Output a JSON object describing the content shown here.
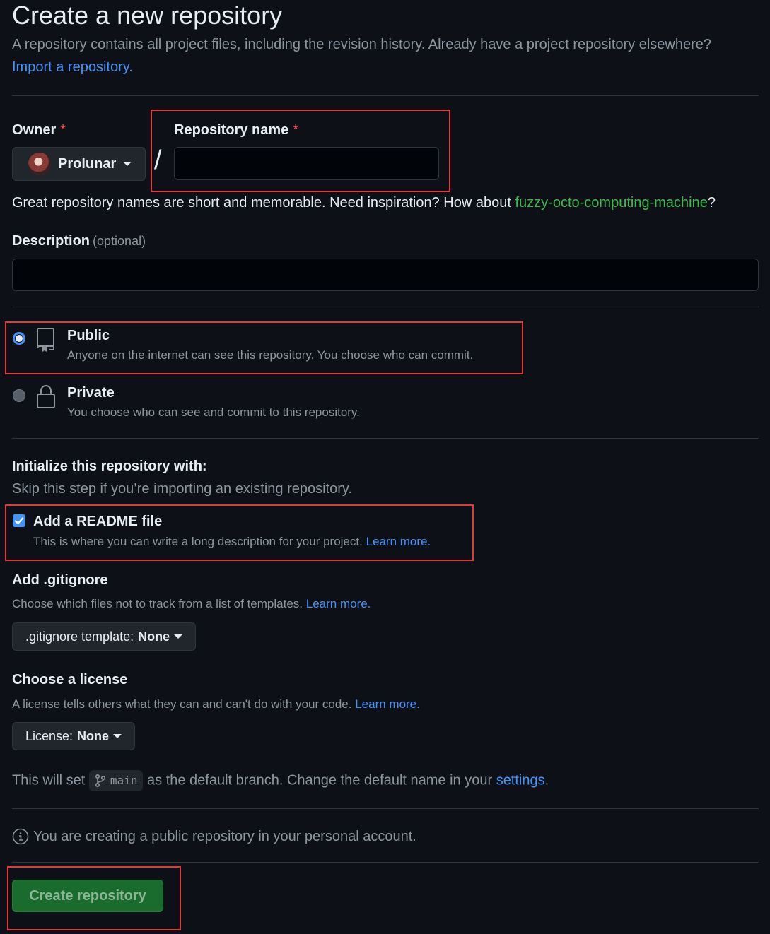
{
  "header": {
    "title": "Create a new repository",
    "subtitle": "A repository contains all project files, including the revision history. Already have a project repository elsewhere?",
    "import_link": "Import a repository."
  },
  "owner": {
    "label": "Owner",
    "required_mark": "*",
    "value": "Prolunar"
  },
  "repo_name": {
    "label": "Repository name",
    "required_mark": "*",
    "value": "",
    "separator": "/"
  },
  "name_hint": {
    "text": "Great repository names are short and memorable. Need inspiration? How about ",
    "suggestion": "fuzzy-octo-computing-machine",
    "suffix": "?"
  },
  "description": {
    "label": "Description",
    "optional": "(optional)",
    "value": ""
  },
  "visibility": {
    "selected": "public",
    "public": {
      "title": "Public",
      "desc": "Anyone on the internet can see this repository. You choose who can commit."
    },
    "private": {
      "title": "Private",
      "desc": "You choose who can see and commit to this repository."
    }
  },
  "initialize": {
    "title": "Initialize this repository with:",
    "subtitle": "Skip this step if you’re importing an existing repository.",
    "readme": {
      "checked": true,
      "label": "Add a README file",
      "desc": "This is where you can write a long description for your project.",
      "learn_more": "Learn more."
    }
  },
  "gitignore": {
    "title": "Add .gitignore",
    "desc": "Choose which files not to track from a list of templates.",
    "learn_more": "Learn more.",
    "button_prefix": ".gitignore template:",
    "button_value": "None"
  },
  "license": {
    "title": "Choose a license",
    "desc": "A license tells others what they can and can't do with your code.",
    "learn_more": "Learn more.",
    "button_prefix": "License:",
    "button_value": "None"
  },
  "branch": {
    "prefix": "This will set",
    "name": "main",
    "middle": "as the default branch. Change the default name in your",
    "settings_link": "settings",
    "suffix": "."
  },
  "notice": {
    "text": "You are creating a public repository in your personal account."
  },
  "submit": {
    "label": "Create repository"
  },
  "colors": {
    "background": "#0d1117",
    "link": "#4493f8",
    "suggestion": "#3fb950",
    "create_button": "#196c2e",
    "highlight_box": "#e5383b"
  }
}
